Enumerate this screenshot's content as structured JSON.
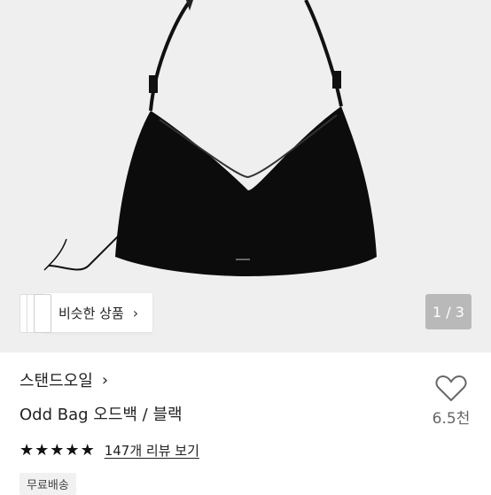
{
  "similar": {
    "label": "비슷한 상품"
  },
  "pager": {
    "text": "1 / 3"
  },
  "product": {
    "brand": "스탠드오일",
    "title": "Odd Bag 오드백 / 블랙",
    "rating": 5,
    "reviews_label": "147개 리뷰 보기",
    "shipping_badge": "무료배송"
  },
  "like": {
    "count": "6.5천"
  },
  "icons": {
    "similar_chevron": "chevron-right-icon",
    "brand_chevron": "chevron-right-icon",
    "heart": "heart-icon",
    "star": "star-icon"
  },
  "colors": {
    "bag": "#0c0c0c",
    "background": "#efefef"
  }
}
